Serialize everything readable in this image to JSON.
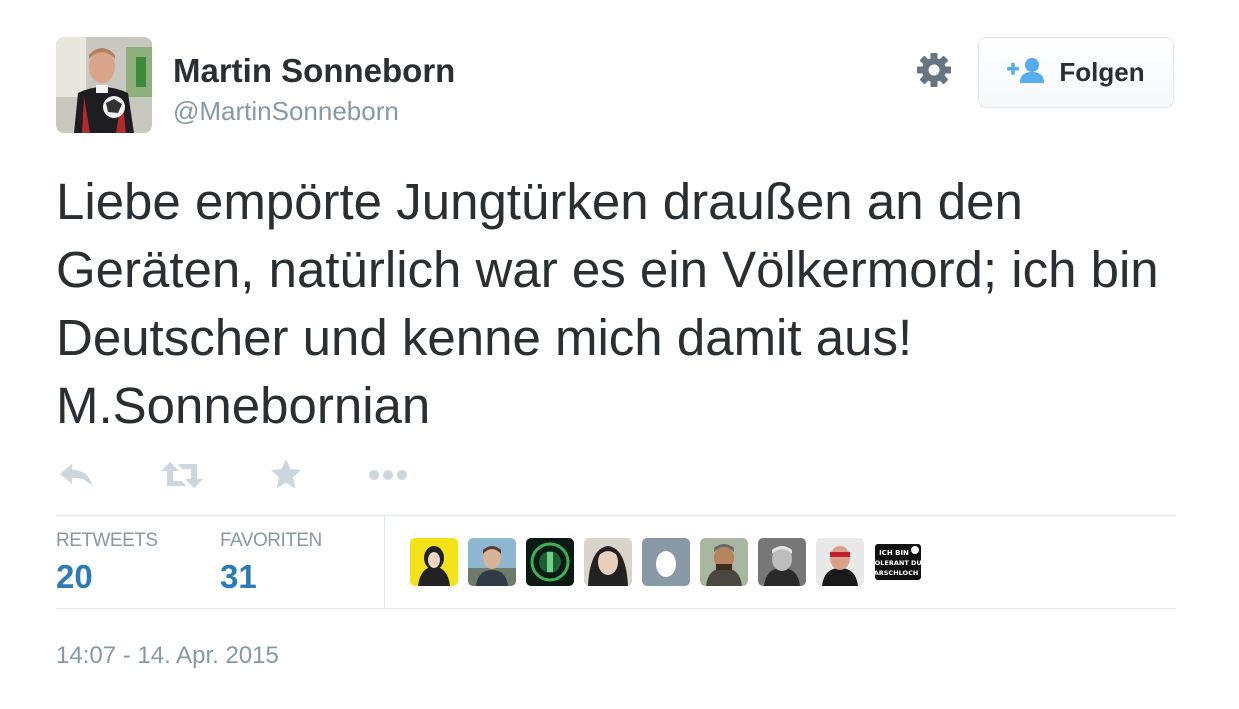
{
  "user": {
    "fullname": "Martin Sonneborn",
    "handle": "@MartinSonneborn"
  },
  "follow_button": {
    "label": "Folgen",
    "icon": "follow-user-plus-icon"
  },
  "settings": {
    "icon": "gear-icon"
  },
  "tweet": {
    "text": "Liebe empörte Jungtürken draußen an den Geräten, natürlich war es ein Völkermord; ich bin Deutscher und kenne mich damit aus! M.Sonnebornian"
  },
  "actions": [
    {
      "name": "reply",
      "icon": "reply-icon"
    },
    {
      "name": "retweet",
      "icon": "retweet-icon"
    },
    {
      "name": "favorite",
      "icon": "star-icon"
    },
    {
      "name": "more",
      "icon": "ellipsis-icon"
    }
  ],
  "stats": {
    "retweets": {
      "label": "RETWEETS",
      "value": "20"
    },
    "favorites": {
      "label": "FAVORITEN",
      "value": "31"
    }
  },
  "favoriter_badge_text": [
    "ICH BIN",
    "TOLERANT DU",
    "ARSCHLOCH"
  ],
  "timestamp": "14:07 - 14. Apr. 2015",
  "colors": {
    "text": "#292f33",
    "muted": "#8899a6",
    "stat_value": "#2b7bb9",
    "action_icon": "#ccd6dd",
    "border": "#e1e8ed",
    "follow_icon": "#55acee"
  }
}
